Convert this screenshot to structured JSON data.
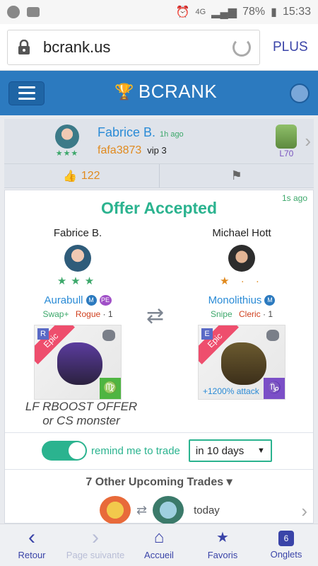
{
  "statusbar": {
    "battery": "78%",
    "time": "15:33",
    "net": "4G"
  },
  "browser": {
    "url": "bcrank.us",
    "plus_label": "PLUS"
  },
  "app": {
    "brand": "BCRANK"
  },
  "profile": {
    "name": "Fabrice B.",
    "time": "1h ago",
    "handle": "fafa3873",
    "vip": "vip 3",
    "level": "L70",
    "likes": "122"
  },
  "offer": {
    "ago": "1s ago",
    "title": "Offer Accepted",
    "left": {
      "user": "Fabrice B.",
      "stars": "★★★",
      "monster": "Aurabull",
      "badges": [
        "M",
        "PE"
      ],
      "trait1": "Swap+",
      "trait2": "Rogue",
      "trait3": "· 1",
      "rarity": "Epic",
      "tag": "R",
      "zodiac": "♍",
      "note_line1": "LF RBOOST OFFER",
      "note_line2": "or CS monster"
    },
    "right": {
      "user": "Michael Hott",
      "stars": "★ · ·",
      "monster": "Monolithius",
      "badges": [
        "M"
      ],
      "trait1": "Snipe",
      "trait2": "Cleric",
      "trait3": "· 1",
      "rarity": "Epic",
      "tag": "E",
      "zodiac": "♑",
      "boost": "+1200% attack"
    }
  },
  "remind": {
    "label": "remind me to trade",
    "selected": "in 10 days"
  },
  "upcoming": {
    "title": "7 Other Upcoming Trades ▾",
    "row_time": "today"
  },
  "nav": [
    {
      "label": "Retour",
      "icon": "‹"
    },
    {
      "label": "Page suivante",
      "icon": "›"
    },
    {
      "label": "Accueil",
      "icon": "⌂"
    },
    {
      "label": "Favoris",
      "icon": "★"
    },
    {
      "label": "Onglets",
      "icon": "6"
    }
  ]
}
